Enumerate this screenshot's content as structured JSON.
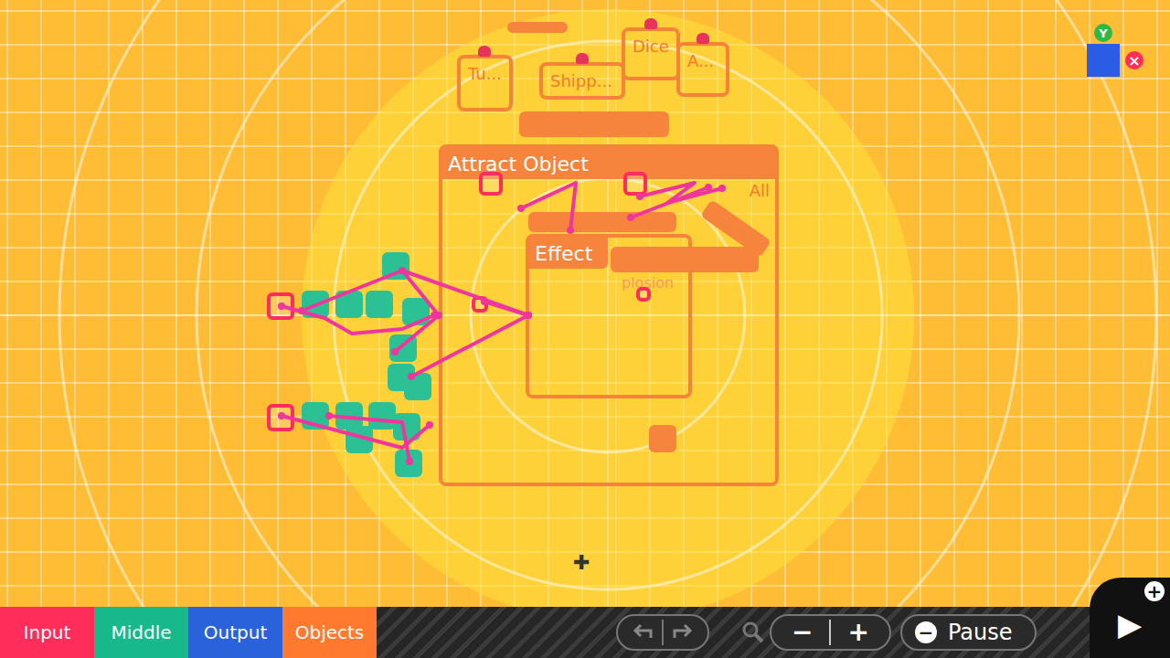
{
  "header_nodes": [
    {
      "label": "Tu..."
    },
    {
      "label": "Shipp..."
    },
    {
      "label": "Dice"
    },
    {
      "label": "A..."
    }
  ],
  "frames": [
    {
      "title": "Attract Object",
      "badge": "All"
    },
    {
      "title": "Effect",
      "badge": "plosion"
    }
  ],
  "palette_tabs": [
    {
      "label": "Input",
      "color": "#ff2d5a"
    },
    {
      "label": "Middle",
      "color": "#17b889"
    },
    {
      "label": "Output",
      "color": "#2a62dc"
    },
    {
      "label": "Objects",
      "color": "#ff7a2e"
    }
  ],
  "zoom": {
    "minus": "−",
    "plus": "+"
  },
  "pause": {
    "icon": "−",
    "label": "Pause"
  },
  "play": {
    "icon": "▶",
    "badge": "+"
  },
  "camera": {
    "button": "Y",
    "close": "×"
  },
  "cursor": "✚"
}
